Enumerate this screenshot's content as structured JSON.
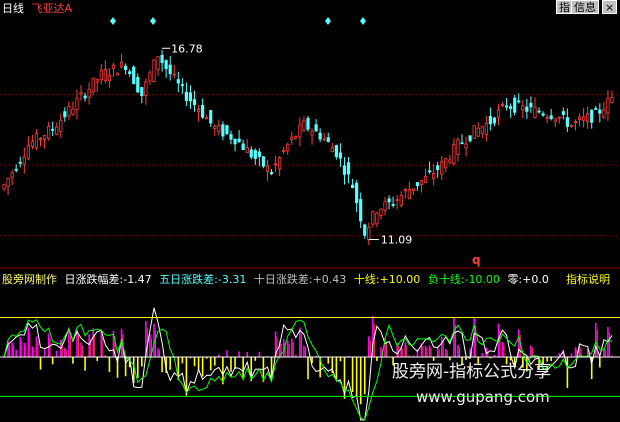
{
  "header": {
    "period": "日线",
    "stock_name": "飞亚达A",
    "btn_indicator": "指",
    "btn_info": "信息",
    "btn_close": "×"
  },
  "price_panel": {
    "high_label": "16.78",
    "low_label": "11.09",
    "marker": "q",
    "gridline_prices": [
      11.2,
      13.3,
      15.4
    ]
  },
  "indicator_bar": {
    "maker": "股旁网制作",
    "items": [
      {
        "label": "日涨跌幅差:",
        "value": "-1.47"
      },
      {
        "label": "五日涨跌差:",
        "value": "-3.31"
      },
      {
        "label": "十日涨跌差:",
        "value": "+0.43"
      },
      {
        "label": "十线:",
        "value": "+10.00"
      },
      {
        "label": "负十线:",
        "value": "-10.00"
      },
      {
        "label": "零:",
        "value": "+0.0"
      }
    ],
    "help": "指标说明"
  },
  "watermark": {
    "line1": "股旁网-指标公式分享",
    "line2": "www.gupang.com"
  },
  "colors": {
    "up": "#ff3c3c",
    "down": "#54ffff",
    "grid": "#880000",
    "upper_line": "#ffff00",
    "lower_line": "#00ff00",
    "zero_line": "#ffffff",
    "bar_pos": "#ff00ff",
    "bar_neg": "#ffff00"
  },
  "chart_data": {
    "type": "candlestick",
    "price_range": [
      10.3,
      17.8
    ],
    "high": 16.78,
    "low": 11.09,
    "indicator_range": [
      -16,
      18
    ],
    "reference_lines": [
      10,
      -10,
      0
    ]
  }
}
